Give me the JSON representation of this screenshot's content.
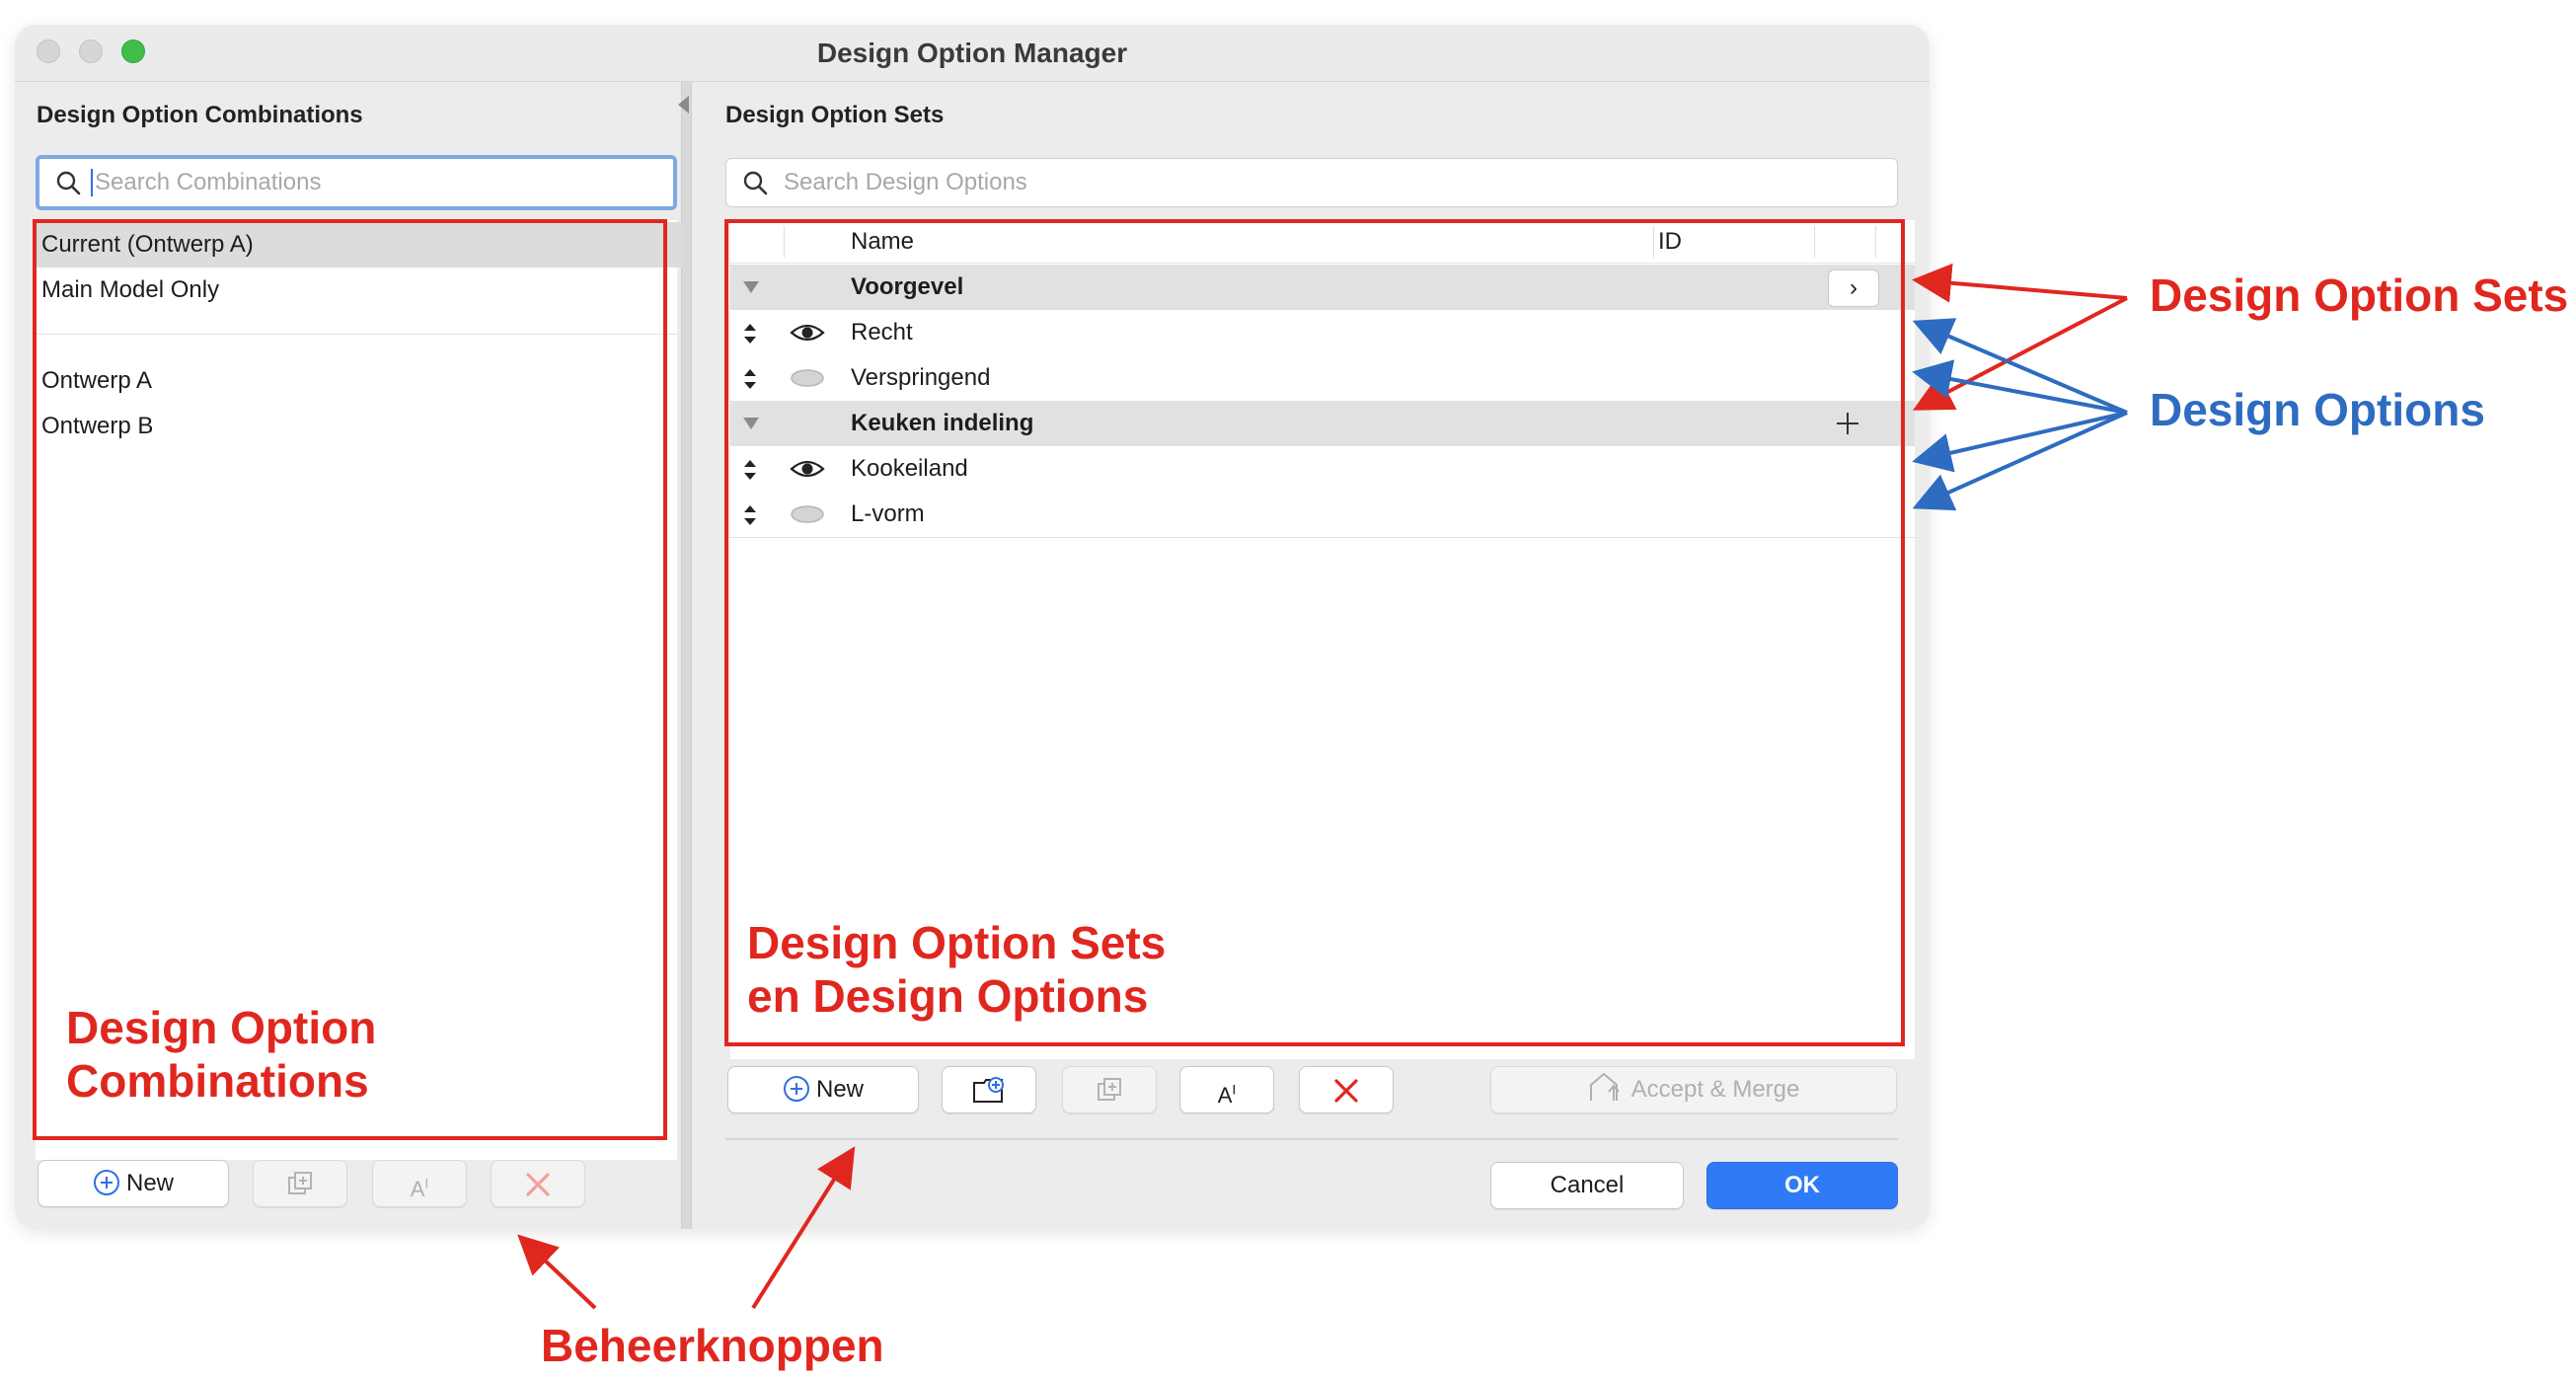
{
  "window": {
    "title": "Design Option Manager"
  },
  "left_panel": {
    "title": "Design Option Combinations",
    "search_placeholder": "Search Combinations",
    "items": [
      "Current (Ontwerp A)",
      "Main Model Only",
      "Ontwerp A",
      "Ontwerp B"
    ],
    "buttons": {
      "new_label": "New"
    }
  },
  "right_panel": {
    "title": "Design Option Sets",
    "search_placeholder": "Search Design Options",
    "columns": {
      "name": "Name",
      "id": "ID"
    },
    "rows": [
      {
        "type": "set",
        "name": "Voorgevel"
      },
      {
        "type": "option",
        "name": "Recht",
        "visible": true
      },
      {
        "type": "option",
        "name": "Verspringend",
        "visible": false
      },
      {
        "type": "set",
        "name": "Keuken indeling"
      },
      {
        "type": "option",
        "name": "Kookeiland",
        "visible": true
      },
      {
        "type": "option",
        "name": "L-vorm",
        "visible": false
      }
    ],
    "buttons": {
      "new_label": "New",
      "accept_merge_label": "Accept & Merge",
      "cancel_label": "Cancel",
      "ok_label": "OK"
    }
  },
  "annotations": {
    "left_box_line1": "Design Option",
    "left_box_line2": "Combinations",
    "right_box_line1": "Design Option Sets",
    "right_box_line2": "en Design Options",
    "sets_callout": "Design Option Sets",
    "options_callout": "Design Options",
    "buttons_callout": "Beheerknoppen"
  },
  "colors": {
    "annotation_red": "#e0271f",
    "annotation_blue": "#2d6cc0",
    "primary_button": "#2f7af6",
    "focus_ring": "#7fa7e6"
  }
}
